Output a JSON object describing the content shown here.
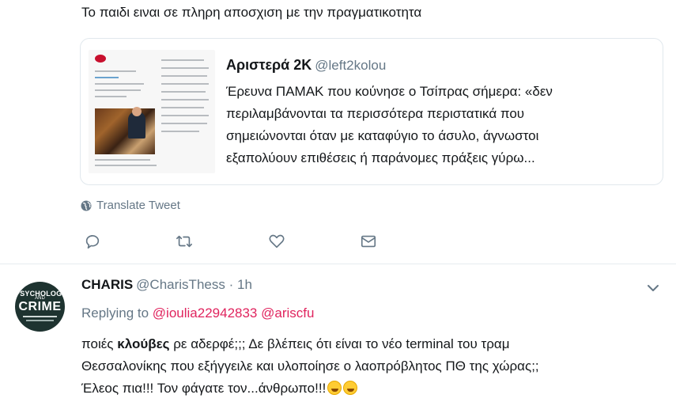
{
  "tweet": {
    "text": "Το παιδι ειναι σε πληρη αποσχιση με την πραγματικοτητα"
  },
  "quote": {
    "name": "Αριστερά 2Κ",
    "handle": "@left2kolou",
    "lines": [
      "Έρευνα ΠΑΜΑΚ που κούνησε ο Τσίπρας σήμερα: «δεν",
      "περιλαμβάνονται τα περισσότερα περιστατικά που",
      "σημειώνονται όταν με καταφύγιο το άσυλο, άγνωστοι",
      "εξαπολύουν επιθέσεις ή παράνομες πράξεις γύρω..."
    ]
  },
  "translate_label": "Translate Tweet",
  "actions": {
    "reply_icon": "reply-icon",
    "retweet_icon": "retweet-icon",
    "like_icon": "heart-icon",
    "dm_icon": "mail-icon"
  },
  "reply": {
    "avatar_text": {
      "line1": "PSYCHOLOGY",
      "line2": "AND",
      "line3": "CRIME"
    },
    "name": "CHARIS",
    "handle": "@CharisThess",
    "dot": "·",
    "time": "1h",
    "replying_prefix": "Replying to",
    "mention1": "@ioulia22942833",
    "mention2": "@ariscfu",
    "line1_a": "ποιές ",
    "line1_bold": "κλούβες",
    "line1_b": " ρε αδερφέ;;; Δε βλέπεις ότι είναι το νέο terminal του τραμ",
    "line2": "Θεσσαλονίκης που εξήγγειλε και υλοποίησε ο λαοπρόβλητος ΠΘ της χώρας;;",
    "line3": "Έλεος πια!!! Τον φάγατε τον...άνθρωπο!!!",
    "emoji_name": "rolling-on-the-floor-laughing"
  },
  "colors": {
    "link": "#e0245e",
    "muted": "#657786",
    "text": "#14171a",
    "border": "#e1e8ed"
  }
}
